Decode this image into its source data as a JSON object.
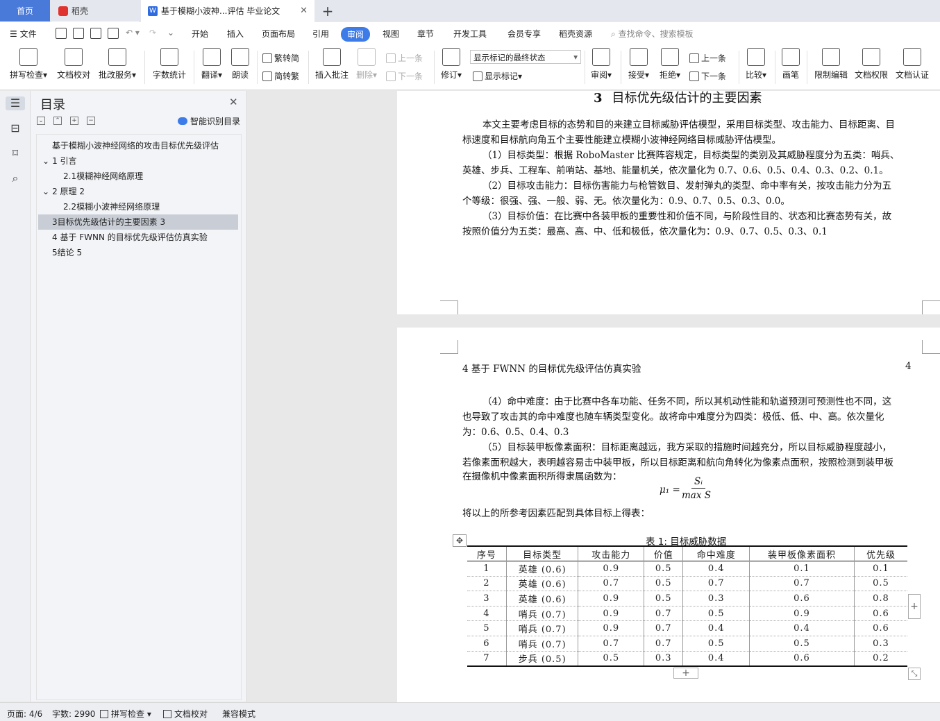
{
  "tabs": {
    "home": "首页",
    "daoke": "稻壳",
    "doc": "基于模糊小波神...评估 毕业论文"
  },
  "menu": {
    "file": "文件",
    "items": [
      "开始",
      "插入",
      "页面布局",
      "引用",
      "审阅",
      "视图",
      "章节",
      "开发工具",
      "会员专享",
      "稻壳资源"
    ],
    "active": "审阅",
    "search": "查找命令、搜索模板"
  },
  "ribbon": {
    "spell": "拼写检查",
    "proof": "文档校对",
    "grade": "批改服务",
    "wordcount": "字数统计",
    "translate": "翻译",
    "read": "朗读",
    "trad_to_simp": "繁转简",
    "simp_to_trad": "简转繁",
    "insert_comment": "插入批注",
    "delete": "删除",
    "prev": "上一条",
    "next": "下一条",
    "track": "修订",
    "track_state": "显示标记的最终状态",
    "show_markup": "显示标记",
    "review": "审阅",
    "accept": "接受",
    "reject": "拒绝",
    "prev2": "上一条",
    "next2": "下一条",
    "compare": "比较",
    "pen": "画笔",
    "restrict": "限制编辑",
    "permission": "文档权限",
    "certify": "文档认证"
  },
  "toc": {
    "title": "目录",
    "smart": "智能识别目录",
    "items": [
      "基于模糊小波神经网络的攻击目标优先级评估",
      "1 引言",
      "2.1模糊神经网络原理",
      "2 原理 2",
      "2.2模糊小波神经网络原理",
      "3目标优先级估计的主要因素 3",
      "4 基于 FWNN 的目标优先级评估仿真实验",
      "5结论 5"
    ]
  },
  "page1": {
    "heading_num": "3",
    "heading": "目标优先级估计的主要因素",
    "lines": [
      "本文主要考虑目标的态势和目的来建立目标威胁评估模型，采用目标类型、攻击能力、目标距离、目",
      "标速度和目标航向角五个主要性能建立模糊小波神经网络目标威胁评估模型。",
      "（1）目标类型：根据 RoboMaster 比赛阵容规定，目标类型的类别及其威胁程度分为五类：哨兵、",
      "英雄、步兵、工程车、前哨站、基地、能量机关，依次量化为 0.7、0.6、0.5、0.4、0.3、0.2、0.1。",
      "（2）目标攻击能力：目标伤害能力与枪管数目、发射弹丸的类型、命中率有关，按攻击能力分为五",
      "个等级：很强、强、一般、弱、无。依次量化为：0.9、0.7、0.5、0.3、0.0。",
      "（3）目标价值：在比赛中各装甲板的重要性和价值不同，与阶段性目的、状态和比赛态势有关，故",
      "按照价值分为五类：最高、高、中、低和极低，依次量化为：0.9、0.7、0.5、0.3、0.1"
    ]
  },
  "page2": {
    "header_left": "4   基于 FWNN 的目标优先级评估仿真实验",
    "header_right": "4",
    "lines": [
      "（4）命中难度：由于比赛中各车功能、任务不同，所以其机动性能和轨道预测可预测性也不同，这",
      "也导致了攻击其的命中难度也随车辆类型变化。故将命中难度分为四类：极低、低、中、高。依次量化",
      "为：0.6、0.5、0.4、0.3",
      "（5）目标装甲板像素面积：目标距离越远，我方采取的措施时间越充分，所以目标威胁程度越小，",
      "若像素面积越大，表明越容易击中装甲板，所以目标距离和航向角转化为像素点面积，按照检测到装甲板",
      "在摄像机中像素面积所得隶属函数为："
    ],
    "formula_lhs": "μ₁ =",
    "formula_num": "Sᵢ",
    "formula_den": "max S",
    "after_formula": "将以上的所参考因素匹配到具体目标上得表：",
    "table_caption": "表 1: 目标威胁数据"
  },
  "table": {
    "headers": [
      "序号",
      "目标类型",
      "攻击能力",
      "价值",
      "命中难度",
      "装甲板像素面积",
      "优先级"
    ],
    "rows": [
      [
        "1",
        "英雄 (0.6)",
        "0.9",
        "0.5",
        "0.4",
        "0.1",
        "0.1"
      ],
      [
        "2",
        "英雄 (0.6)",
        "0.7",
        "0.5",
        "0.7",
        "0.7",
        "0.5"
      ],
      [
        "3",
        "英雄 (0.6)",
        "0.9",
        "0.5",
        "0.3",
        "0.6",
        "0.8"
      ],
      [
        "4",
        "哨兵 (0.7)",
        "0.9",
        "0.7",
        "0.5",
        "0.9",
        "0.6"
      ],
      [
        "5",
        "哨兵 (0.7)",
        "0.9",
        "0.7",
        "0.4",
        "0.4",
        "0.6"
      ],
      [
        "6",
        "哨兵 (0.7)",
        "0.7",
        "0.7",
        "0.5",
        "0.5",
        "0.3"
      ],
      [
        "7",
        "步兵 (0.5)",
        "0.5",
        "0.3",
        "0.4",
        "0.6",
        "0.2"
      ]
    ]
  },
  "status": {
    "page": "页面: 4/6",
    "words": "字数: 2990",
    "spell": "拼写检查",
    "proof": "文档校对",
    "compat": "兼容模式"
  }
}
